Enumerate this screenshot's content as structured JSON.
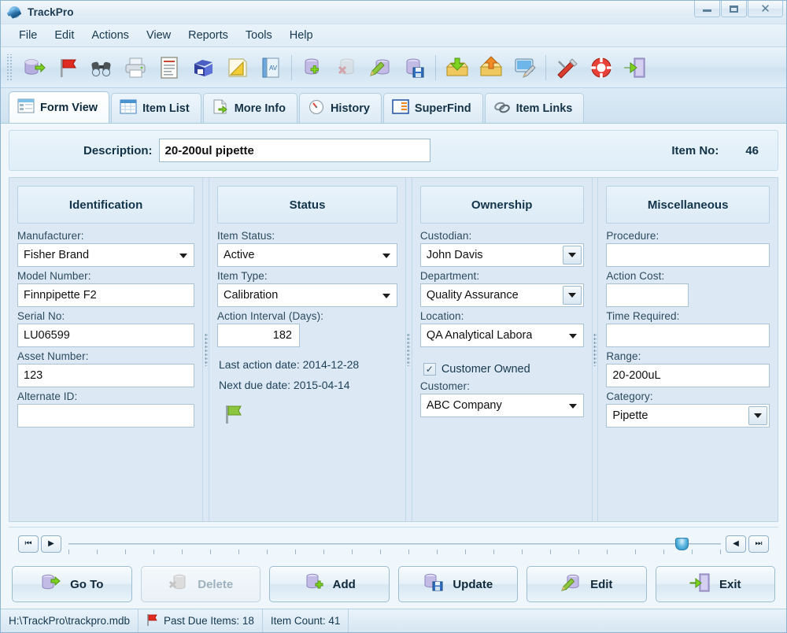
{
  "window": {
    "title": "TrackPro",
    "icon": "trackpro-globe-icon",
    "minimize": "Minimize",
    "maximize": "Maximize",
    "close": "Close"
  },
  "menubar": {
    "items": [
      {
        "label": "File"
      },
      {
        "label": "Edit"
      },
      {
        "label": "Actions"
      },
      {
        "label": "View"
      },
      {
        "label": "Reports"
      },
      {
        "label": "Tools"
      },
      {
        "label": "Help"
      }
    ]
  },
  "toolbar": {
    "buttons": [
      {
        "name": "open-database-icon",
        "title": "Open Database"
      },
      {
        "name": "red-flag-icon",
        "title": "Past Due Items"
      },
      {
        "name": "binoculars-icon",
        "title": "Find"
      },
      {
        "name": "printer-icon",
        "title": "Print"
      },
      {
        "name": "report-list-icon",
        "title": "Reports"
      },
      {
        "name": "label-printer-icon",
        "title": "Labels"
      },
      {
        "name": "triangle-ruler-icon",
        "title": "Calibration"
      },
      {
        "name": "notebook-icon",
        "title": "Notes"
      },
      {
        "name": "add-record-icon",
        "title": "Add Record"
      },
      {
        "name": "delete-record-icon",
        "title": "Delete Record"
      },
      {
        "name": "edit-record-icon",
        "title": "Edit Record"
      },
      {
        "name": "save-record-icon",
        "title": "Save Record"
      },
      {
        "name": "import-icon",
        "title": "Import"
      },
      {
        "name": "export-icon",
        "title": "Export"
      },
      {
        "name": "screen-edit-icon",
        "title": "Customize Screen"
      },
      {
        "name": "tools-icon",
        "title": "Tools"
      },
      {
        "name": "lifering-help-icon",
        "title": "Support"
      },
      {
        "name": "exit-door-icon",
        "title": "Exit"
      }
    ]
  },
  "tabs": [
    {
      "label": "Form View",
      "icon": "form-view-icon",
      "active": true
    },
    {
      "label": "Item List",
      "icon": "item-list-grid-icon",
      "active": false
    },
    {
      "label": "More Info",
      "icon": "more-info-page-icon",
      "active": false
    },
    {
      "label": "History",
      "icon": "history-clock-icon",
      "active": false
    },
    {
      "label": "SuperFind",
      "icon": "superfind-panel-icon",
      "active": false
    },
    {
      "label": "Item Links",
      "icon": "item-links-chain-icon",
      "active": false
    }
  ],
  "header": {
    "description_label": "Description:",
    "description_value": "20-200ul pipette",
    "item_no_label": "Item No:",
    "item_no_value": "46"
  },
  "panels": {
    "identification": {
      "title": "Identification",
      "manufacturer_label": "Manufacturer:",
      "manufacturer_value": "Fisher Brand",
      "model_number_label": "Model Number:",
      "model_number_value": "Finnpipette F2",
      "serial_no_label": "Serial No:",
      "serial_no_value": "LU06599",
      "asset_number_label": "Asset Number:",
      "asset_number_value": "123",
      "alternate_id_label": "Alternate ID:",
      "alternate_id_value": ""
    },
    "status": {
      "title": "Status",
      "item_status_label": "Item Status:",
      "item_status_value": "Active",
      "item_type_label": "Item Type:",
      "item_type_value": "Calibration",
      "action_interval_label": "Action Interval (Days):",
      "action_interval_value": "182",
      "last_action_date": "Last action date: 2014-12-28",
      "next_due_date": "Next due date: 2015-04-14",
      "flag_icon": "green-flag-icon"
    },
    "ownership": {
      "title": "Ownership",
      "custodian_label": "Custodian:",
      "custodian_value": "John Davis",
      "department_label": "Department:",
      "department_value": "Quality Assurance",
      "location_label": "Location:",
      "location_value": "QA Analytical Labora",
      "customer_owned_label": "Customer Owned",
      "customer_owned_checked": "✓",
      "customer_label": "Customer:",
      "customer_value": "ABC Company"
    },
    "miscellaneous": {
      "title": "Miscellaneous",
      "procedure_label": "Procedure:",
      "procedure_value": "",
      "action_cost_label": "Action Cost:",
      "action_cost_value": "",
      "time_required_label": "Time Required:",
      "time_required_value": "",
      "range_label": "Range:",
      "range_value": "20-200uL",
      "category_label": "Category:",
      "category_value": "Pipette"
    }
  },
  "navigation": {
    "first_label": "⏮",
    "next_label": "▶",
    "prev_label": "◀",
    "last_label": "⏭",
    "slider_position_percent": 93
  },
  "actions": [
    {
      "label": "Go To",
      "icon": "goto-database-icon",
      "disabled": false
    },
    {
      "label": "Delete",
      "icon": "delete-database-icon",
      "disabled": true
    },
    {
      "label": "Add",
      "icon": "add-database-icon",
      "disabled": false
    },
    {
      "label": "Update",
      "icon": "update-save-icon",
      "disabled": false
    },
    {
      "label": "Edit",
      "icon": "edit-pencil-database-icon",
      "disabled": false
    },
    {
      "label": "Exit",
      "icon": "exit-door-icon",
      "disabled": false
    }
  ],
  "statusbar": {
    "database_path": "H:\\TrackPro\\trackpro.mdb",
    "flag_icon": "red-flag-icon",
    "past_due": "Past Due Items: 18",
    "item_count": "Item Count: 41"
  },
  "colors": {
    "accent": "#1b83bb",
    "panel_bg": "#dce9f4",
    "content_bg": "#f0f7fc",
    "text": "#12354c",
    "flag_green": "#8cc63e",
    "flag_red": "#e02b20"
  }
}
